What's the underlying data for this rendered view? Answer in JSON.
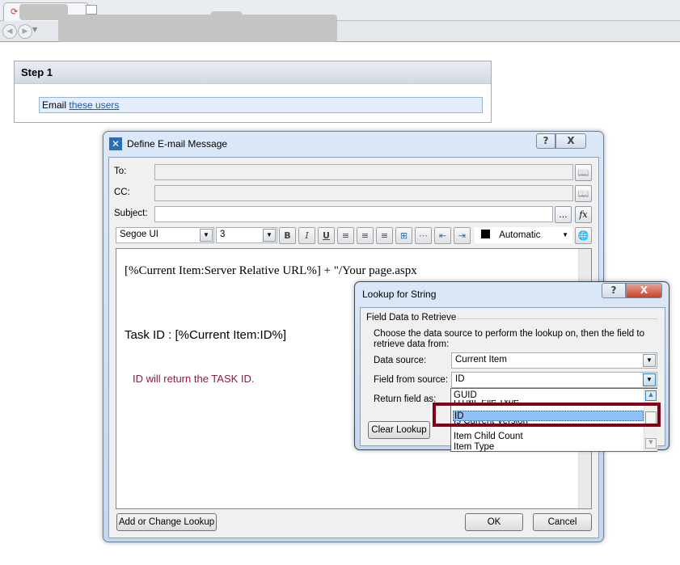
{
  "browser": {
    "back_icon": "back-arrow-icon",
    "forward_icon": "forward-arrow-icon"
  },
  "step": {
    "title": "Step 1",
    "action_text": "Email",
    "link_text": "these users"
  },
  "email_dialog": {
    "title": "Define E-mail Message",
    "help": "?",
    "close": "X",
    "to_label": "To:",
    "to_value": "",
    "cc_label": "CC:",
    "cc_value": "",
    "subject_label": "Subject:",
    "subject_value": "",
    "ellipsis": "...",
    "fx": "fx",
    "font": "Segoe UI",
    "size": "3",
    "bold": "B",
    "italic": "I",
    "underline": "U",
    "color_label": "Automatic",
    "color": "#000000",
    "body": {
      "line1": "[%Current Item:Server Relative URL%] + \"/Your page.aspx",
      "line2": "Task ID : [%Current Item:ID%]",
      "line3": "ID will return the TASK ID.",
      "line3_color": "#8b1a4a"
    },
    "add_lookup": "Add or Change Lookup",
    "ok": "OK",
    "cancel": "Cancel"
  },
  "lookup_dialog": {
    "title": "Lookup for String",
    "help": "?",
    "close": "X",
    "group": "Field Data to Retrieve",
    "description": "Choose the data source to perform the lookup on, then the field to retrieve data from:",
    "data_source_label": "Data source:",
    "data_source": "Current Item",
    "field_label": "Field from source:",
    "field": "ID",
    "return_label": "Return field as:",
    "clear": "Clear Lookup",
    "options": [
      "GUID",
      "HTML File Type",
      "ID",
      "Is Current Version",
      "Item Child Count",
      "Item Type"
    ],
    "selected": "ID",
    "highlight_color": "#800016"
  }
}
